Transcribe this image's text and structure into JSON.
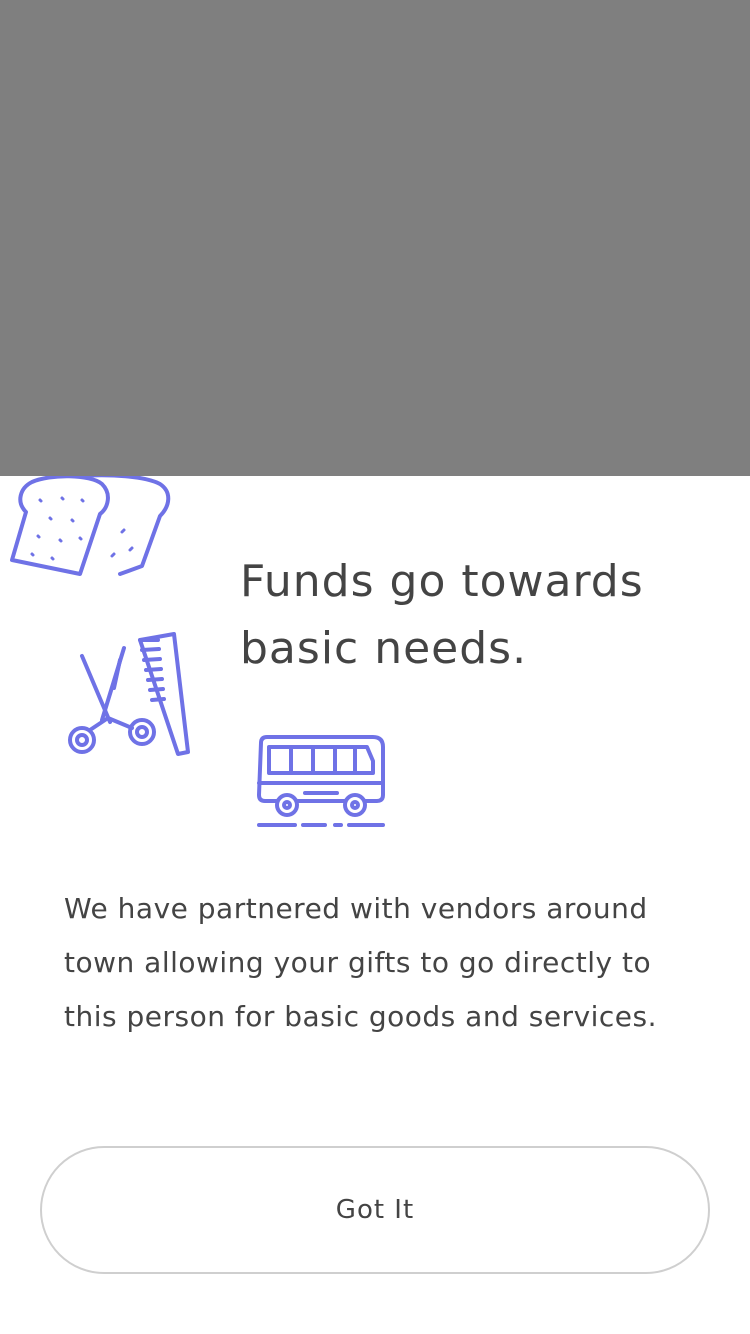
{
  "colors": {
    "overlay": "#7f7f7f",
    "icon_accent": "#6f72e6",
    "text": "#444444",
    "button_border": "#cfcfcf"
  },
  "icons": [
    "bread-icon",
    "scissors-comb-icon",
    "bus-icon"
  ],
  "modal": {
    "title": "Funds go towards basic needs.",
    "body": "We have partnered with vendors around town allowing your gifts to go directly to this person for basic goods and services.",
    "button_label": "Got It"
  }
}
